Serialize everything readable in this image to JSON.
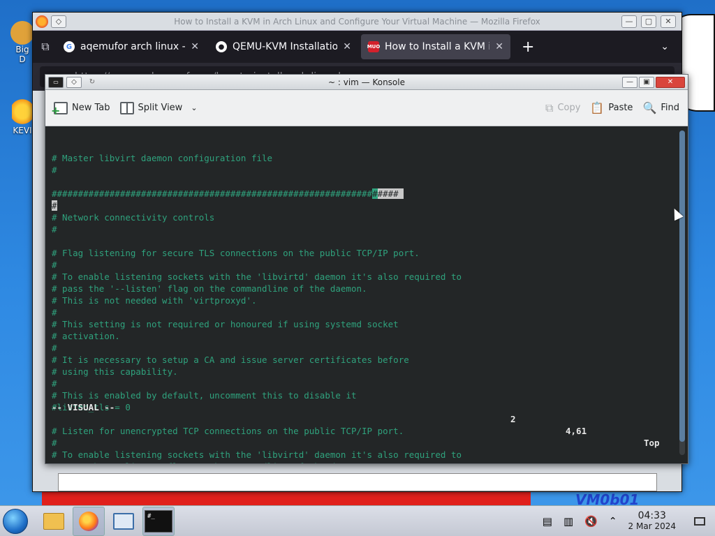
{
  "desktop": {
    "icons": [
      {
        "label": "Big\nD",
        "name": "desktop-icon-big"
      },
      {
        "label": "KEVI",
        "name": "desktop-icon-kevi"
      }
    ],
    "wall_text": "VM0b01"
  },
  "firefox": {
    "title": "How to Install a KVM in Arch Linux and Configure Your Virtual Machine — Mozilla Firefox",
    "tabs": [
      {
        "label": "aqemufor arch linux - Go",
        "favicon": "google-icon"
      },
      {
        "label": "QEMU-KVM Installation fo",
        "favicon": "github-icon"
      },
      {
        "label": "How to Install a KVM in A",
        "favicon": "makeuseof-icon"
      }
    ],
    "url": "https://www.makeuseof.com/how-to-install-arch-linux-kvm-co"
  },
  "konsole": {
    "title": "~ : vim — Konsole",
    "toolbar": {
      "new_tab": "New Tab",
      "split_view": "Split View",
      "copy": "Copy",
      "paste": "Paste",
      "find": "Find"
    },
    "lines": [
      {
        "text": "# Master libvirt daemon configuration file"
      },
      {
        "text": "#"
      },
      {
        "text": ""
      },
      {
        "pre": "#############################################################",
        "cursor": "#",
        "hl": "#### "
      },
      {
        "pre": "",
        "hl": "#",
        "text": ""
      },
      {
        "text": "# Network connectivity controls"
      },
      {
        "text": "#"
      },
      {
        "text": ""
      },
      {
        "text": "# Flag listening for secure TLS connections on the public TCP/IP port."
      },
      {
        "text": "#"
      },
      {
        "text": "# To enable listening sockets with the 'libvirtd' daemon it's also required to"
      },
      {
        "text": "# pass the '--listen' flag on the commandline of the daemon."
      },
      {
        "text": "# This is not needed with 'virtproxyd'."
      },
      {
        "text": "#"
      },
      {
        "text": "# This setting is not required or honoured if using systemd socket"
      },
      {
        "text": "# activation."
      },
      {
        "text": "#"
      },
      {
        "text": "# It is necessary to setup a CA and issue server certificates before"
      },
      {
        "text": "# using this capability."
      },
      {
        "text": "#"
      },
      {
        "text": "# This is enabled by default, uncomment this to disable it"
      },
      {
        "text": "#listen_tls = 0"
      },
      {
        "text": ""
      },
      {
        "text": "# Listen for unencrypted TCP connections on the public TCP/IP port."
      },
      {
        "text": "#"
      },
      {
        "text": "# To enable listening sockets with the 'libvirtd' daemon it's also required to"
      },
      {
        "text": "# pass the '--listen' flag on the commandline of the daemon."
      }
    ],
    "status": {
      "mode": "-- VISUAL --",
      "selected": "2",
      "position": "4,61",
      "scroll": "Top"
    }
  },
  "taskbar": {
    "apps": [
      "file-manager-icon",
      "firefox-icon",
      "control-panel-icon",
      "konsole-icon"
    ],
    "time": "04:33",
    "date": "2 Mar 2024"
  }
}
